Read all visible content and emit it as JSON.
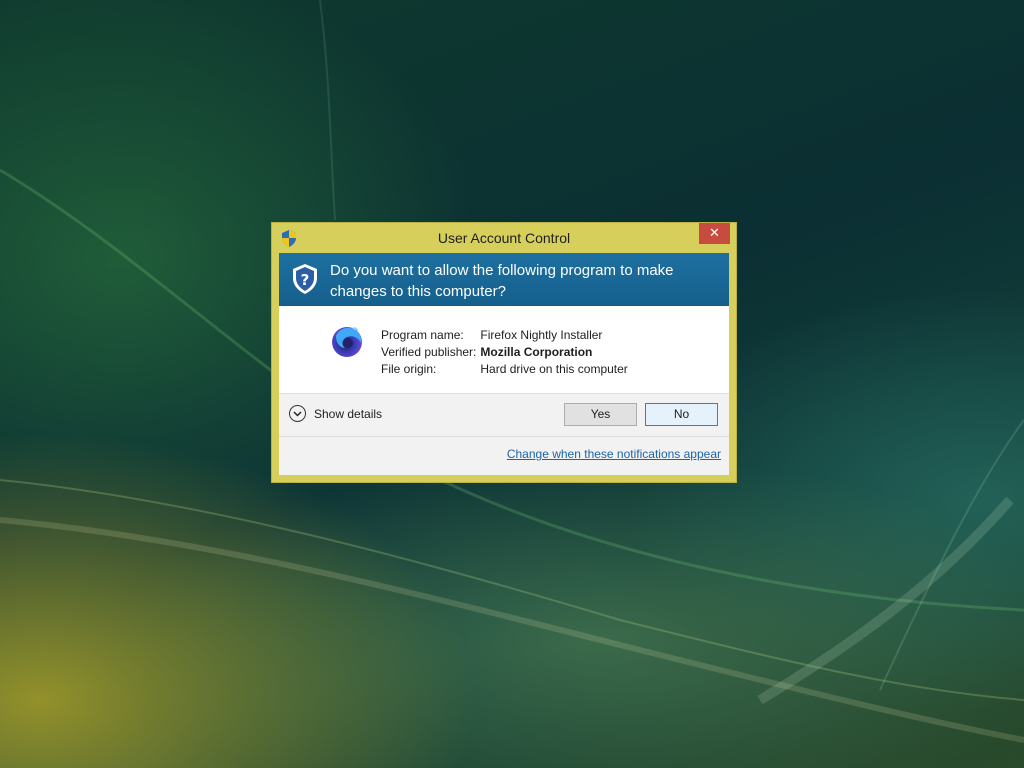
{
  "dialog": {
    "title": "User Account Control",
    "close_glyph": "✕",
    "question": "Do you want to allow the following program to make changes to this computer?",
    "info": [
      {
        "label": "Program name:",
        "value": "Firefox Nightly Installer",
        "bold": false
      },
      {
        "label": "Verified publisher:",
        "value": "Mozilla Corporation",
        "bold": true
      },
      {
        "label": "File origin:",
        "value": "Hard drive on this computer",
        "bold": false
      }
    ],
    "show_details_label": "Show details",
    "yes_label": "Yes",
    "no_label": "No",
    "footer_link": "Change when these notifications appear"
  },
  "icons": {
    "title_icon": "uac-shield-icon",
    "header_icon": "uac-shield-icon",
    "program_icon": "firefox-nightly-icon",
    "details_icon": "chevron-down-icon",
    "close_icon": "close-icon"
  },
  "colors": {
    "window_frame": "#d7cf5c",
    "header_band": "#1e70a0",
    "close_button": "#c84b3f",
    "link": "#1a64a8"
  }
}
